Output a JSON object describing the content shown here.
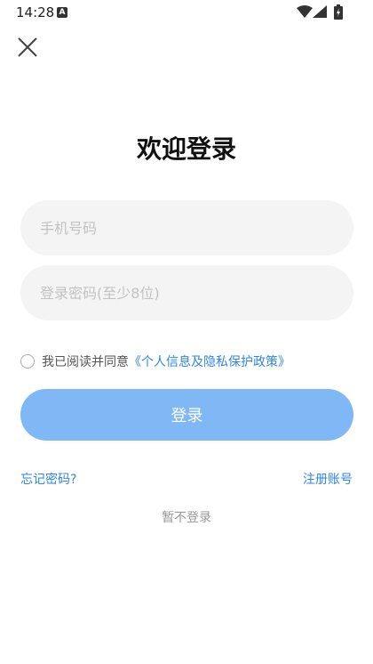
{
  "status_bar": {
    "time": "14:28",
    "notification_icon": "A"
  },
  "header": {
    "close_icon": "close-icon"
  },
  "title": "欢迎登录",
  "form": {
    "phone_placeholder": "手机号码",
    "phone_value": "",
    "password_placeholder": "登录密码(至少8位)",
    "password_value": ""
  },
  "agreement": {
    "checked": false,
    "text": "我已阅读并同意",
    "link_text": "《个人信息及隐私保护政策》"
  },
  "login_button": "登录",
  "links": {
    "forgot_password": "忘记密码?",
    "register": "注册账号",
    "skip_login": "暂不登录"
  },
  "colors": {
    "accent": "#2f86e6",
    "button": "#7fb8f5",
    "input_bg": "#f4f4f4"
  }
}
